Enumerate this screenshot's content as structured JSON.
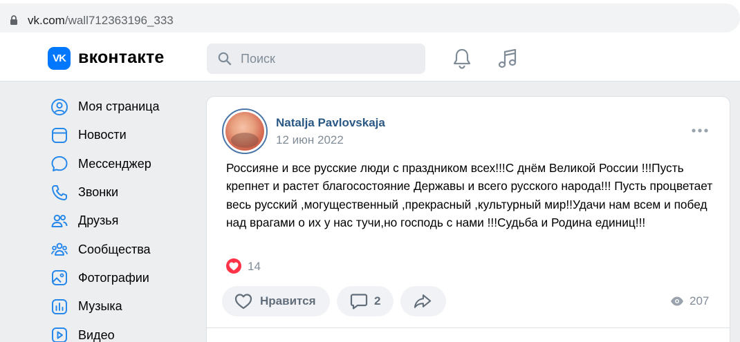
{
  "browser": {
    "url_domain": "vk.com",
    "url_path": "/wall712363196_333"
  },
  "header": {
    "logo_mark": "VK",
    "logo_text": "вконтакте",
    "search_placeholder": "Поиск",
    "icons": [
      "bell-icon",
      "music-icon"
    ],
    "brand_color": "#0077ff"
  },
  "sidebar": {
    "items": [
      {
        "label": "Моя страница",
        "icon": "user-circle-icon"
      },
      {
        "label": "Новости",
        "icon": "newsfeed-icon"
      },
      {
        "label": "Мессенджер",
        "icon": "message-icon"
      },
      {
        "label": "Звонки",
        "icon": "phone-icon"
      },
      {
        "label": "Друзья",
        "icon": "friends-icon"
      },
      {
        "label": "Сообщества",
        "icon": "communities-icon"
      },
      {
        "label": "Фотографии",
        "icon": "photo-icon"
      },
      {
        "label": "Музыка",
        "icon": "music-chart-icon"
      },
      {
        "label": "Видео",
        "icon": "video-icon"
      }
    ]
  },
  "post": {
    "author": "Natalja Pavlovskaja",
    "date": "12 июн 2022",
    "text": "Россияне и все русские люди с праздником всех!!!С днём Великой России !!!Пусть крепнет и растет благосостояние Державы и всего русского народа!!! Пусть процветает весь русский ,могущественный ,прекрасный ,культурный мир!!Удачи нам всем и побед над врагами о их у нас тучи,но господь с нами !!!Судьба и Родина единиц!!!",
    "likes_count": "14",
    "like_label": "Нравится",
    "comments_count": "2",
    "views_count": "207",
    "accent_color": "#ff3347"
  }
}
